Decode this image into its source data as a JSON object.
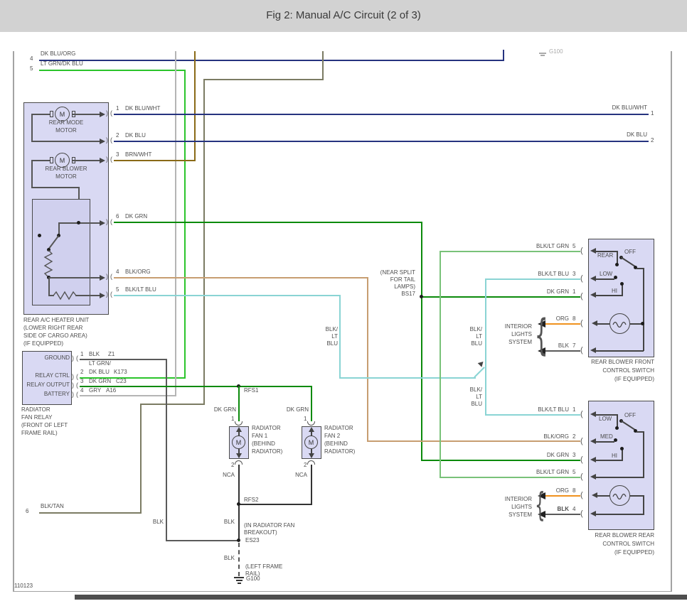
{
  "header": {
    "title": "Fig 2: Manual A/C Circuit (2 of 3)"
  },
  "colors": {
    "dk_blu": "#26337f",
    "lt_grn": "#2bc42b",
    "dk_grn": "#0b8a0b",
    "blk_lt_grn": "#79c279",
    "blk_lt_blu": "#8ad4d4",
    "blk_org": "#c79e71",
    "brn_wht": "#8a6a17",
    "gry": "#b5b5b5",
    "blk": "#5a5a5a",
    "blk_tan": "#7b7b63",
    "org": "#f0921e",
    "box_fill": "#d9d9f3"
  },
  "top_left": {
    "pin4_num": "4",
    "pin4_label": "DK BLU/ORG",
    "pin5_num": "5",
    "pin5_label": "LT GRN/DK BLU"
  },
  "top_right": {
    "ground_ref": "G100"
  },
  "right_edge": {
    "pin1_label": "DK BLU/WHT",
    "pin1_num": "1",
    "pin2_label": "DK BLU",
    "pin2_num": "2"
  },
  "heater": {
    "motor_letter": "M",
    "mode_motor": [
      "REAR MODE",
      "MOTOR"
    ],
    "blower_motor": [
      "REAR BLOWER",
      "MOTOR"
    ],
    "pins": [
      {
        "num": "1",
        "label": "DK BLU/WHT"
      },
      {
        "num": "2",
        "label": "DK BLU"
      },
      {
        "num": "3",
        "label": "BRN/WHT"
      },
      {
        "num": "6",
        "label": "DK GRN"
      },
      {
        "num": "4",
        "label": "BLK/ORG"
      },
      {
        "num": "5",
        "label": "BLK/LT BLU"
      }
    ],
    "caption": [
      "REAR A/C HEATER UNIT",
      "(LOWER RIGHT REAR",
      "SIDE OF CARGO AREA)",
      "(IF EQUIPPED)"
    ]
  },
  "relay": {
    "terminals": [
      "GROUND",
      "RELAY CTRL",
      "RELAY OUTPUT",
      "BATTERY"
    ],
    "wire1": {
      "num": "1",
      "label": "BLK",
      "code": "Z1"
    },
    "wire2": {
      "pre": "LT GRN/",
      "num": "2",
      "label": "DK BLU",
      "code": "K173"
    },
    "wire3": {
      "num": "3",
      "label": "DK GRN",
      "code": "C23"
    },
    "wire4": {
      "num": "4",
      "label": "GRY",
      "code": "A16"
    },
    "caption": [
      "RADIATOR",
      "FAN RELAY",
      "(FRONT OF LEFT",
      "FRAME RAIL)"
    ]
  },
  "fans": {
    "rfs1": "RFS1",
    "rfs2": "RFS2",
    "es23": "ES23",
    "g100": "G100",
    "dk_grn": "DK GRN",
    "nca": "NCA",
    "blk": "BLK",
    "motor_letter": "M",
    "pin1": "1",
    "pin2": "2",
    "fan1_caption": [
      "RADIATOR",
      "FAN 1",
      "(BEHIND",
      "RADIATOR)"
    ],
    "fan2_caption": [
      "RADIATOR",
      "FAN 2",
      "(BEHIND",
      "RADIATOR)"
    ],
    "breakout": [
      "(IN RADIATOR FAN",
      "BREAKOUT)"
    ],
    "frame_rail": [
      "(LEFT FRAME",
      "RAIL)"
    ]
  },
  "bottom_left": {
    "num": "6",
    "label": "BLK/TAN"
  },
  "bs17": [
    "(NEAR SPLIT",
    "FOR TAIL",
    "LAMPS)",
    "BS17"
  ],
  "stack": [
    "BLK/",
    "LT",
    "BLU"
  ],
  "front_switch": {
    "wires": [
      {
        "label": "BLK/LT GRN",
        "num": "5"
      },
      {
        "label": "BLK/LT BLU",
        "num": "3"
      },
      {
        "label": "DK GRN",
        "num": "1"
      },
      {
        "label": "ORG",
        "num": "8"
      },
      {
        "label": "BLK",
        "num": "7"
      }
    ],
    "pos_rear": "REAR",
    "pos_off": "OFF",
    "pos_low": "LOW",
    "pos_hi": "HI",
    "interior": [
      "INTERIOR",
      "LIGHTS",
      "SYSTEM"
    ],
    "caption": [
      "REAR BLOWER FRONT",
      "CONTROL SWITCH",
      "(IF EQUIPPED)"
    ]
  },
  "rear_switch": {
    "wires": [
      {
        "label": "BLK/LT BLU",
        "num": "1"
      },
      {
        "label": "BLK/ORG",
        "num": "2"
      },
      {
        "label": "DK GRN",
        "num": "3"
      },
      {
        "label": "BLK/LT GRN",
        "num": "5"
      },
      {
        "label": "ORG",
        "num": "8"
      },
      {
        "label": "BLK",
        "num": "4"
      }
    ],
    "pos_low": "LOW",
    "pos_off": "OFF",
    "pos_med": "MED",
    "pos_hi": "HI",
    "interior": [
      "INTERIOR",
      "LIGHTS",
      "SYSTEM"
    ],
    "caption": [
      "REAR BLOWER REAR",
      "CONTROL SWITCH",
      "(IF EQUIPPED)"
    ]
  },
  "footer": {
    "code": "110123"
  }
}
